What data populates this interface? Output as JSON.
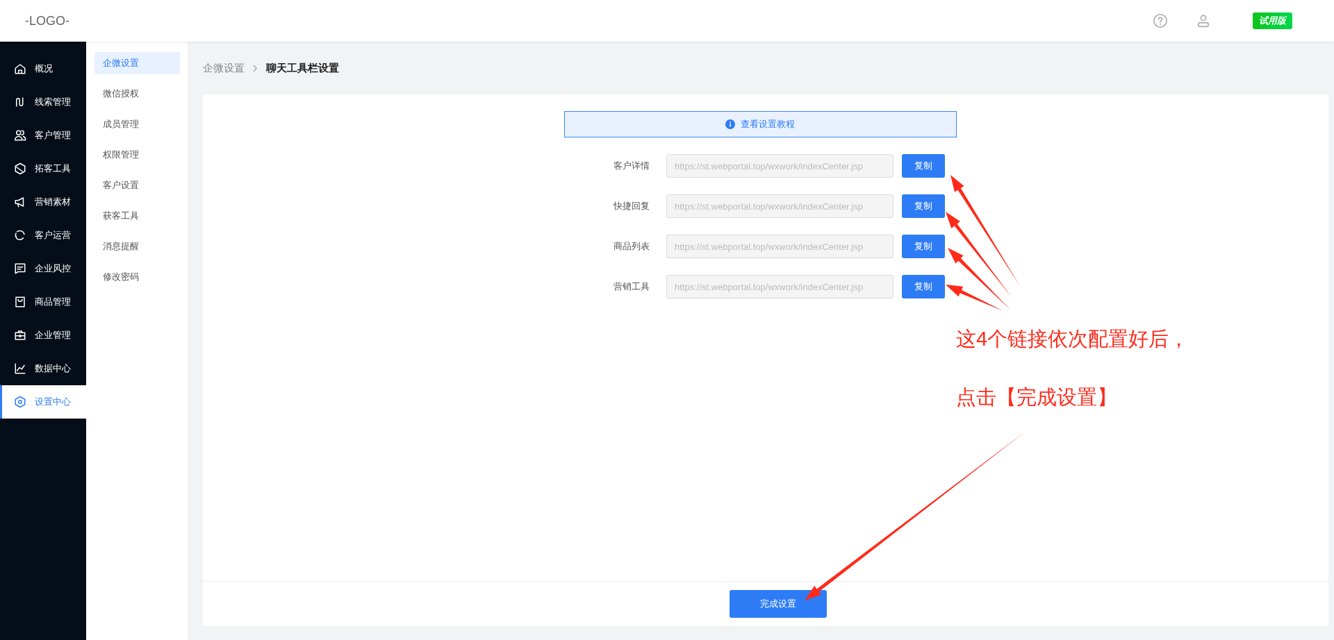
{
  "header": {
    "logo": "-LOGO-",
    "badge": "试用版"
  },
  "nav": [
    {
      "label": "概况",
      "selected": false
    },
    {
      "label": "线索管理",
      "selected": false
    },
    {
      "label": "客户管理",
      "selected": false
    },
    {
      "label": "拓客工具",
      "selected": false
    },
    {
      "label": "营销素材",
      "selected": false
    },
    {
      "label": "客户运营",
      "selected": false
    },
    {
      "label": "企业风控",
      "selected": false
    },
    {
      "label": "商品管理",
      "selected": false
    },
    {
      "label": "企业管理",
      "selected": false
    },
    {
      "label": "数据中心",
      "selected": false
    },
    {
      "label": "设置中心",
      "selected": true
    }
  ],
  "subnav": [
    {
      "label": "企微设置",
      "selected": true
    },
    {
      "label": "微信授权",
      "selected": false
    },
    {
      "label": "成员管理",
      "selected": false
    },
    {
      "label": "权限管理",
      "selected": false
    },
    {
      "label": "客户设置",
      "selected": false
    },
    {
      "label": "获客工具",
      "selected": false
    },
    {
      "label": "消息提醒",
      "selected": false
    },
    {
      "label": "修改密码",
      "selected": false
    }
  ],
  "breadcrumb": [
    "企微设置",
    "聊天工具栏设置"
  ],
  "tutorial_banner": "查看设置教程",
  "links": [
    {
      "label": "客户详情",
      "value": "https://st.webportal.top/wxwork/indexCenter.jsp",
      "disabled": true,
      "button": "复制"
    },
    {
      "label": "快捷回复",
      "value": "https://st.webportal.top/wxwork/indexCenter.jsp",
      "disabled": true,
      "button": "复制"
    },
    {
      "label": "商品列表",
      "value": "https://st.webportal.top/wxwork/indexCenter.jsp",
      "disabled": true,
      "button": "复制"
    },
    {
      "label": "营销工具",
      "value": "https://st.webportal.top/wxwork/indexCenter.jsp",
      "disabled": true,
      "button": "复制"
    }
  ],
  "submit_button": "完成设置",
  "annotation": {
    "lines": [
      "这4个链接依次配置好后，",
      "点击【完成设置】"
    ]
  }
}
